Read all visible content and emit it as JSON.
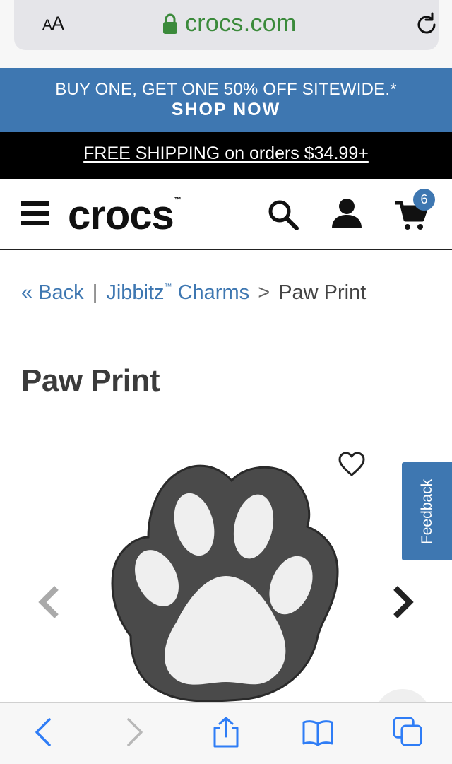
{
  "browser": {
    "text_size_label_small": "A",
    "text_size_label_large": "A",
    "domain": "crocs.com"
  },
  "promo": {
    "line1": "BUY ONE, GET ONE 50% OFF SITEWIDE.*",
    "line2": "SHOP NOW"
  },
  "shipping": {
    "text": "FREE SHIPPING on orders $34.99+"
  },
  "header": {
    "logo": "crocs",
    "logo_tm": "™",
    "cart_count": "6"
  },
  "breadcrumb": {
    "back": "« Back",
    "separator1": "|",
    "category": "Jibbitz",
    "category_tm": "™",
    "category_suffix": " Charms",
    "separator2": ">",
    "current": "Paw Print"
  },
  "product": {
    "title": "Paw Print"
  },
  "feedback": {
    "label": "Feedback"
  },
  "colors": {
    "brand_blue": "#3e77b1",
    "secure_green": "#3b8a3b",
    "banner_black": "#000000",
    "safari_blue": "#2f7df6"
  },
  "icons": {
    "lock": "lock-icon",
    "reload": "reload-icon",
    "menu": "hamburger-icon",
    "search": "search-icon",
    "account": "user-icon",
    "cart": "cart-icon",
    "wishlist": "heart-icon",
    "prev": "chevron-left-icon",
    "next": "chevron-right-icon",
    "back": "back-arrow-icon",
    "forward": "forward-arrow-icon",
    "share": "share-icon",
    "bookmarks": "book-icon",
    "tabs": "tabs-icon"
  }
}
